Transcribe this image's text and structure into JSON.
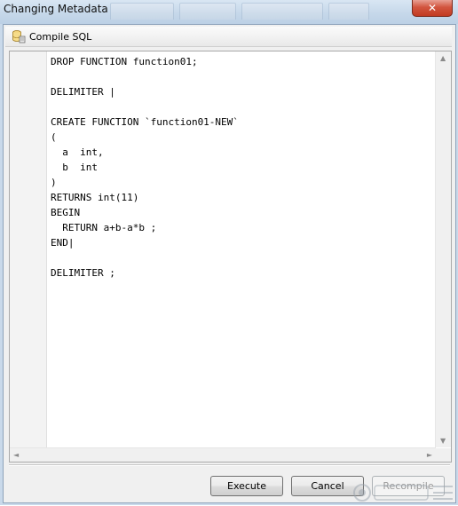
{
  "window": {
    "title": "Changing Metadata",
    "close_glyph": "✕"
  },
  "toolbar": {
    "compile_label": "Compile SQL",
    "compile_icon": "database-icon"
  },
  "editor": {
    "lines": [
      "DROP FUNCTION function01;",
      "",
      "DELIMITER |",
      "",
      "CREATE FUNCTION `function01-NEW`",
      "(",
      "  a  int,",
      "  b  int",
      ")",
      "RETURNS int(11)",
      "BEGIN",
      "  RETURN a+b-a*b ;",
      "END|",
      "",
      "DELIMITER ;"
    ]
  },
  "scrollbars": {
    "up_arrow": "▲",
    "down_arrow": "▼",
    "left_arrow": "◄",
    "right_arrow": "►"
  },
  "buttons": {
    "execute": "Execute",
    "cancel": "Cancel",
    "recompile": "Recompile"
  },
  "colors": {
    "titlebar": "#c6d8ea",
    "close_button": "#c13b22",
    "dialog_bg": "#f0f0f0"
  }
}
